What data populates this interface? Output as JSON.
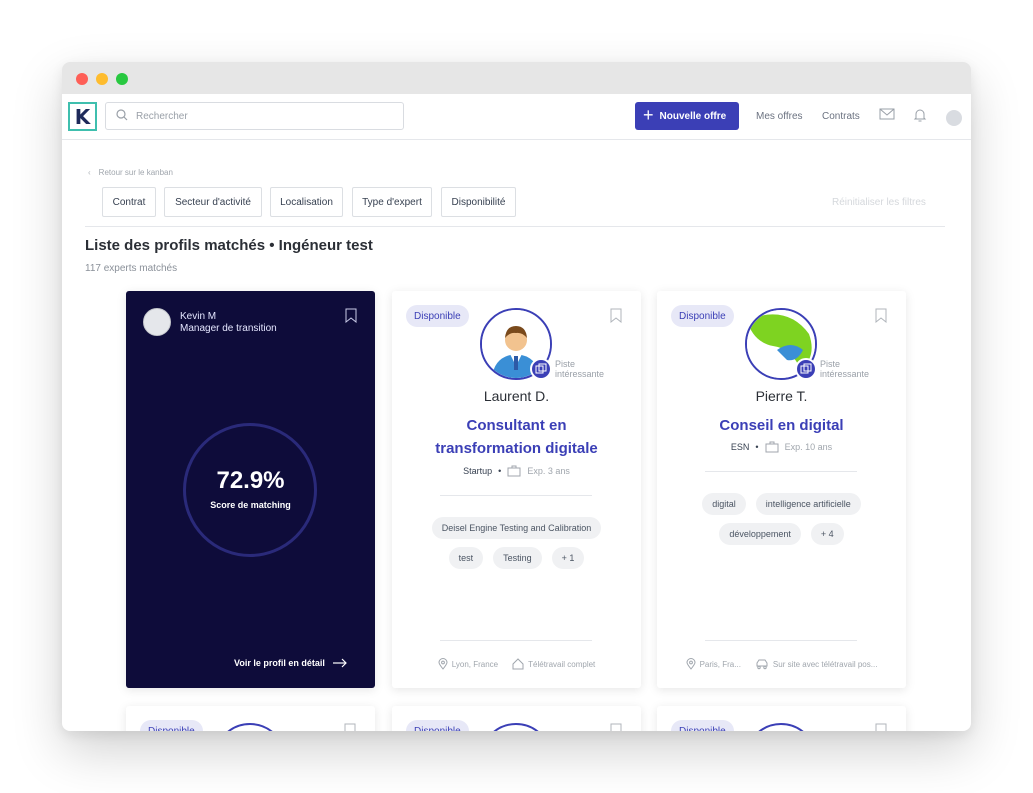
{
  "header": {
    "logo_letter": "K",
    "search_placeholder": "Rechercher",
    "new_offer_label": "Nouvelle offre",
    "links": [
      "Mes offres",
      "Contrats"
    ]
  },
  "filters": {
    "back_label": "Retour sur le kanban",
    "items": [
      "Contrat",
      "Secteur d'activité",
      "Localisation",
      "Type d'expert",
      "Disponibilité"
    ],
    "reset_label": "Réinitialiser les filtres"
  },
  "page": {
    "title": "Liste des profils matchés • Ingéneur test",
    "subtitle": "117 experts matchés"
  },
  "score_card": {
    "name": "Kevin M",
    "role": "Manager de transition",
    "score": "72.9%",
    "score_label": "Score de matching",
    "detail_link": "Voir le profil en détail"
  },
  "profiles": [
    {
      "badge": "Disponible",
      "piste": [
        "Piste",
        "intéressante"
      ],
      "name": "Laurent D.",
      "job_lines": [
        "Consultant en",
        "transformation digitale"
      ],
      "company": "Startup",
      "experience": "Exp. 3 ans",
      "tags": [
        "Deisel Engine Testing and Calibration",
        "test",
        "Testing",
        "+ 1"
      ],
      "location": "Lyon, France",
      "work_mode": "Télétravail complet"
    },
    {
      "badge": "Disponible",
      "piste": [
        "Piste",
        "intéressante"
      ],
      "name": "Pierre T.",
      "job_lines": [
        "Conseil en digital"
      ],
      "company": "ESN",
      "experience": "Exp. 10 ans",
      "tags": [
        "digital",
        "intelligence artificielle",
        "développement",
        "+ 4"
      ],
      "location": "Paris, Fra...",
      "work_mode": "Sur site avec télétravail pos..."
    }
  ],
  "next_row_badges": [
    "Disponible",
    "Disponible",
    "Disponible"
  ],
  "colors": {
    "brand": "#3b3fb6",
    "dark_card": "#0e0c3a",
    "logo_border": "#3fbfae"
  }
}
